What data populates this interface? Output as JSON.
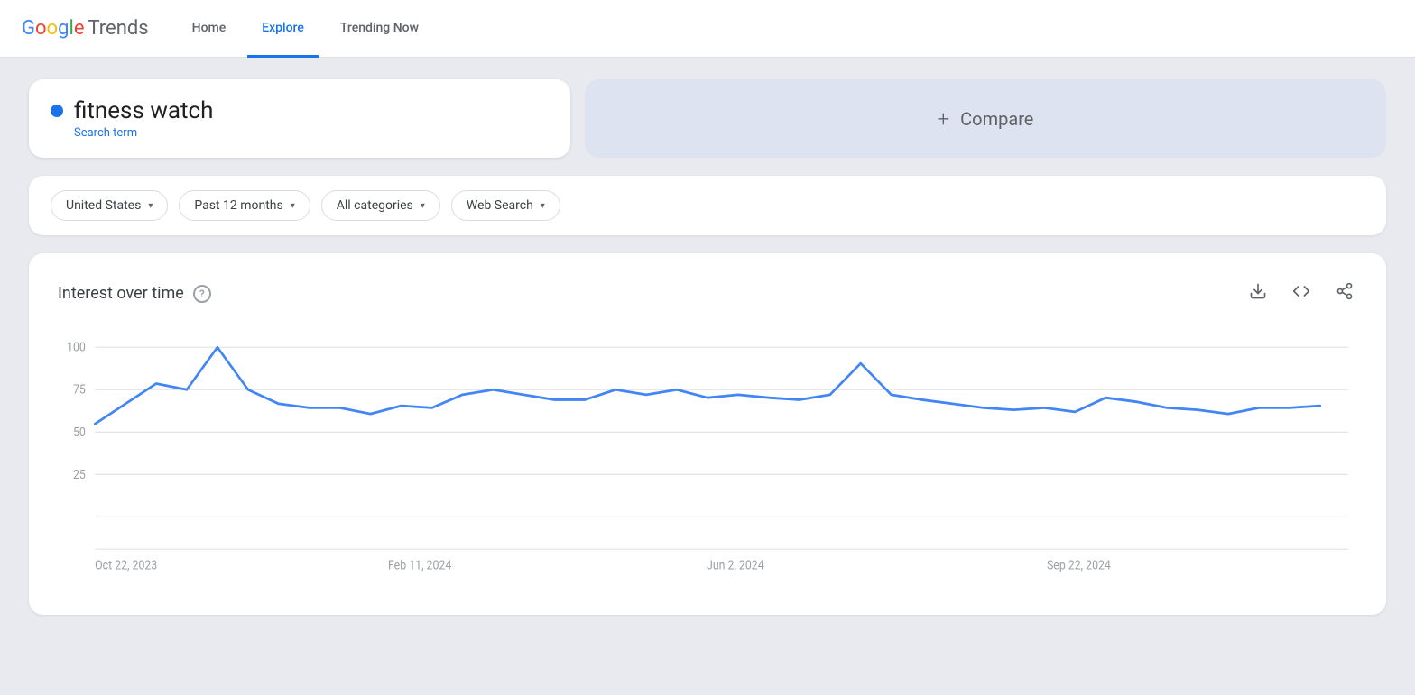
{
  "header": {
    "logo_google": "Google",
    "logo_trends": "Trends",
    "nav": [
      {
        "id": "home",
        "label": "Home",
        "active": false
      },
      {
        "id": "explore",
        "label": "Explore",
        "active": true
      },
      {
        "id": "trending",
        "label": "Trending Now",
        "active": false
      }
    ]
  },
  "search": {
    "term": "fitness watch",
    "type": "Search term",
    "dot_color": "#1a73e8"
  },
  "compare": {
    "plus": "+",
    "label": "Compare"
  },
  "filters": [
    {
      "id": "region",
      "label": "United States",
      "value": "United States"
    },
    {
      "id": "time",
      "label": "Past 12 months",
      "value": "Past 12 months"
    },
    {
      "id": "category",
      "label": "All categories",
      "value": "All categories"
    },
    {
      "id": "search_type",
      "label": "Web Search",
      "value": "Web Search"
    }
  ],
  "chart": {
    "title": "Interest over time",
    "help_text": "?",
    "y_labels": [
      "100",
      "75",
      "50",
      "25"
    ],
    "x_labels": [
      "Oct 22, 2023",
      "Feb 11, 2024",
      "Jun 2, 2024",
      "Sep 22, 2024"
    ],
    "actions": [
      {
        "id": "download",
        "icon": "⬇",
        "label": "Download"
      },
      {
        "id": "embed",
        "icon": "<>",
        "label": "Embed"
      },
      {
        "id": "share",
        "icon": "share",
        "label": "Share"
      }
    ],
    "data_points": [
      62,
      70,
      80,
      77,
      100,
      75,
      70,
      68,
      68,
      65,
      67,
      68,
      74,
      76,
      74,
      72,
      74,
      76,
      78,
      75,
      73,
      74,
      73,
      72,
      74,
      86,
      74,
      72,
      70,
      68,
      67,
      68,
      66,
      72,
      70,
      68,
      67,
      65,
      68,
      70,
      68
    ],
    "line_color": "#4285f4"
  }
}
